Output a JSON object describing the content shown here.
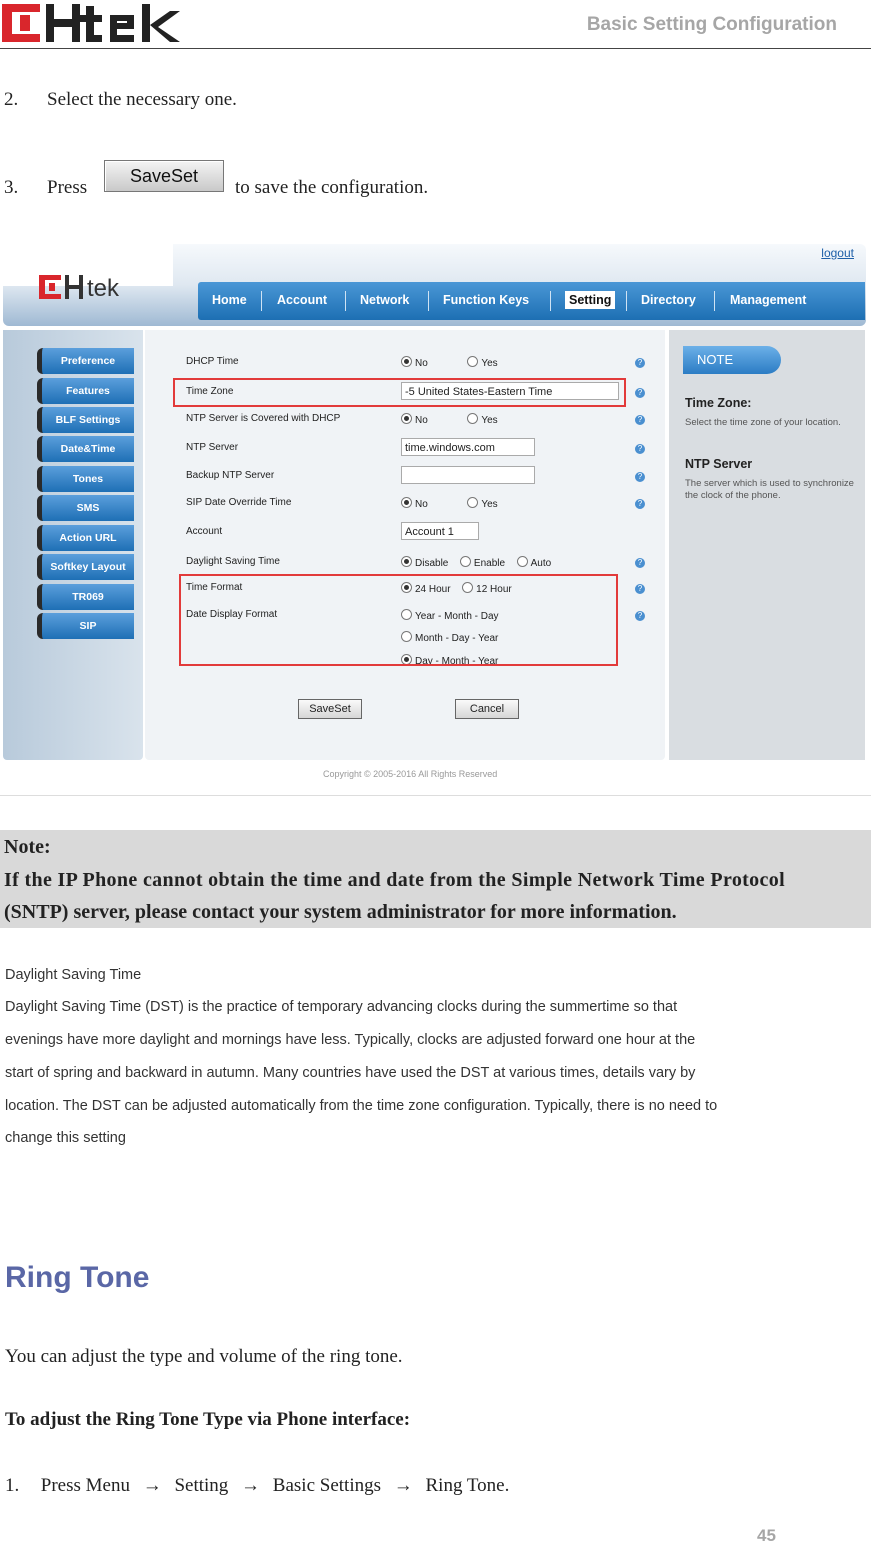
{
  "header": {
    "title": "Basic Setting Configuration"
  },
  "steps": [
    {
      "num": "2.",
      "text": "Select the necessary one."
    },
    {
      "num": "3.",
      "pre": "Press",
      "button": "SaveSet",
      "post": "to save the configuration."
    }
  ],
  "screenshot": {
    "logout": "logout",
    "nav": [
      "Home",
      "Account",
      "Network",
      "Function Keys",
      "Setting",
      "Directory",
      "Management"
    ],
    "active_nav": "Setting",
    "sidebar": [
      "Preference",
      "Features",
      "BLF Settings",
      "Date&Time",
      "Tones",
      "SMS",
      "Action URL",
      "Softkey Layout",
      "TR069",
      "SIP"
    ],
    "fields": {
      "dhcp_time": {
        "label": "DHCP Time",
        "opt1": "No",
        "opt2": "Yes"
      },
      "time_zone": {
        "label": "Time Zone",
        "value": "-5 United States-Eastern Time"
      },
      "ntp_dhcp": {
        "label": "NTP Server is Covered with DHCP",
        "opt1": "No",
        "opt2": "Yes"
      },
      "ntp_server": {
        "label": "NTP Server",
        "value": "time.windows.com"
      },
      "backup_ntp": {
        "label": "Backup NTP Server",
        "value": ""
      },
      "sip_override": {
        "label": "SIP Date Override Time",
        "opt1": "No",
        "opt2": "Yes"
      },
      "account": {
        "label": "Account",
        "value": "Account 1"
      },
      "dst": {
        "label": "Daylight Saving Time",
        "opt1": "Disable",
        "opt2": "Enable",
        "opt3": "Auto"
      },
      "time_format": {
        "label": "Time Format",
        "opt1": "24 Hour",
        "opt2": "12 Hour"
      },
      "date_format": {
        "label": "Date Display Format",
        "opt1": "Year - Month - Day",
        "opt2": "Month - Day - Year",
        "opt3": "Day - Month - Year"
      }
    },
    "save_btn": "SaveSet",
    "cancel_btn": "Cancel",
    "note_tab": "NOTE",
    "note_tz_title": "Time Zone:",
    "note_tz_text": "Select the time zone of your location.",
    "note_ntp_title": "NTP Server",
    "note_ntp_text": "The server which is used to synchronize the clock of the phone.",
    "copyright": "Copyright © 2005-2016 All Rights Reserved"
  },
  "note": {
    "label": "Note:",
    "line1": "If the IP Phone cannot obtain the time and date from the Simple Network Time Protocol",
    "line2": "(SNTP) server, please contact your system administrator for more information."
  },
  "dst_section": {
    "title": "Daylight Saving Time",
    "lines": [
      "Daylight Saving Time (DST) is the practice of temporary advancing clocks during the summertime so that",
      "evenings have more daylight and mornings have less. Typically, clocks are adjusted forward one hour at the",
      "start of spring and backward in autumn. Many countries have used the DST at various times, details vary by",
      "location. The DST can be adjusted automatically from the time zone configuration. Typically, there is no need to",
      "change this setting"
    ]
  },
  "ring": {
    "heading": "Ring Tone",
    "intro": "You can adjust the type and volume of the ring tone.",
    "subhead": "To adjust the Ring Tone Type via Phone interface:",
    "step_num": "1.",
    "step_parts": [
      "Press Menu",
      "Setting",
      "Basic Settings",
      "Ring Tone."
    ],
    "arrow": "→"
  },
  "page_number": "45",
  "colors": {
    "brand_red": "#d9262c",
    "heading": "#5a67a6",
    "nav_blue": "#1d6fb3",
    "highlight": "#e23a3a"
  }
}
